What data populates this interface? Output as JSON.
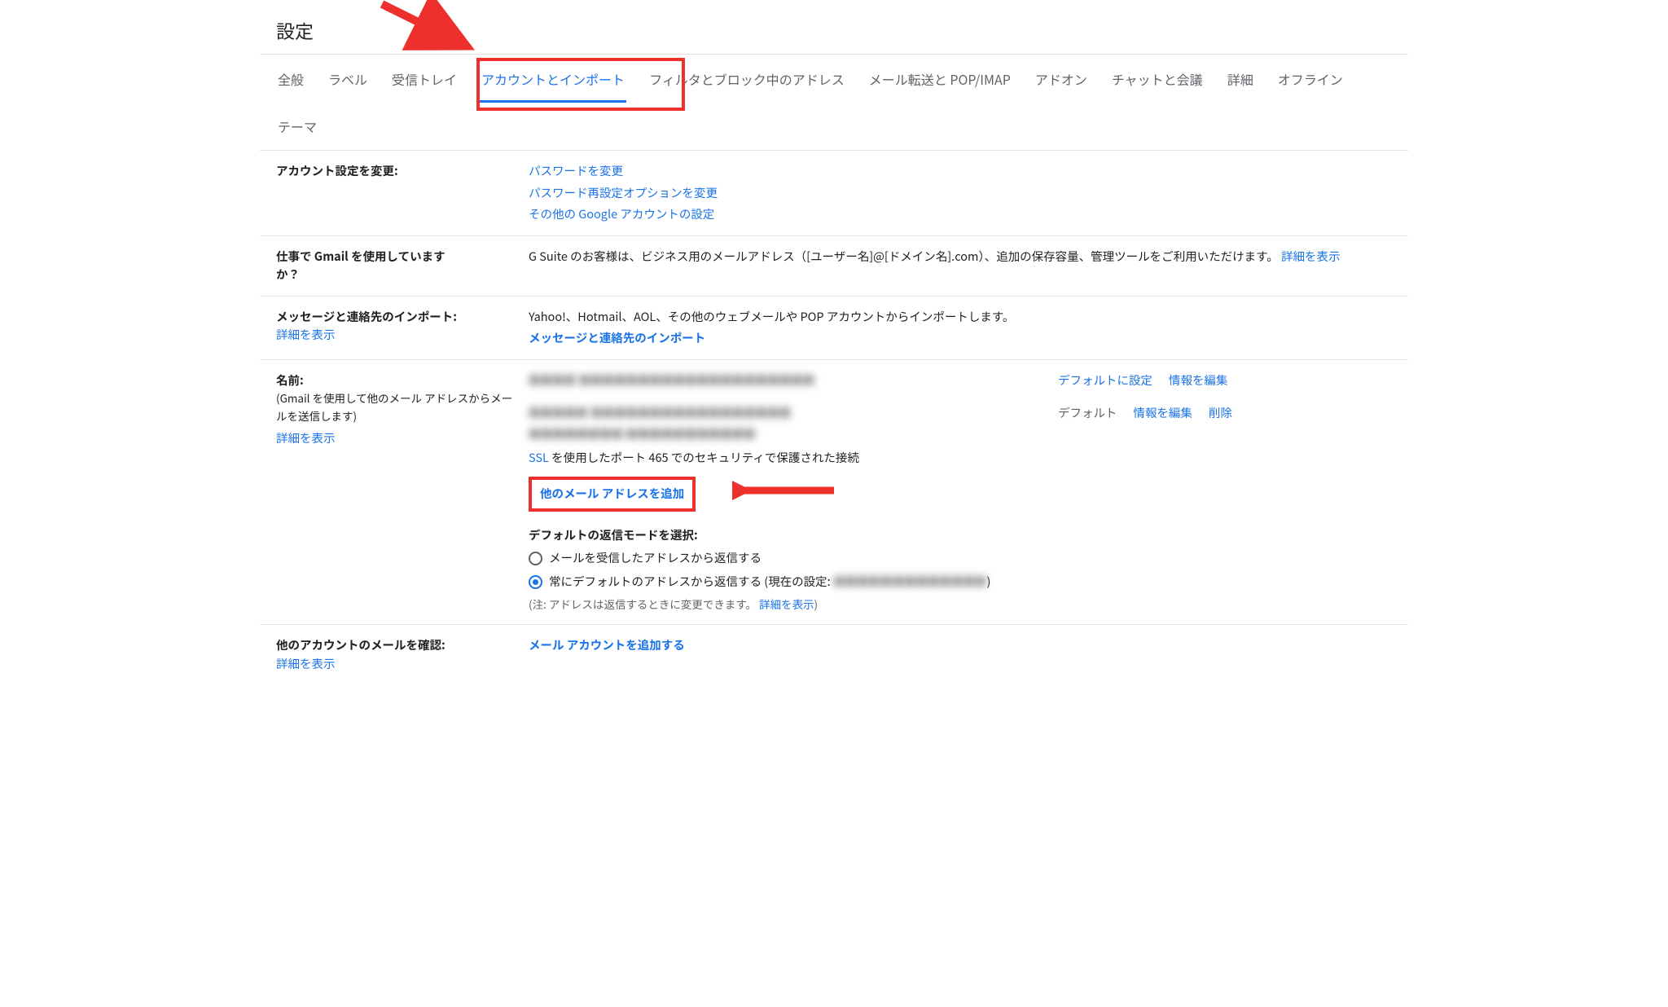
{
  "page_title": "設定",
  "tabs": {
    "general": "全般",
    "labels": "ラベル",
    "inbox": "受信トレイ",
    "accounts": "アカウントとインポート",
    "filters": "フィルタとブロック中のアドレス",
    "forwarding": "メール転送と POP/IMAP",
    "addons": "アドオン",
    "chat": "チャットと会議",
    "advanced": "詳細",
    "offline": "オフライン",
    "themes": "テーマ"
  },
  "sec_account": {
    "label": "アカウント設定を変更:",
    "change_pw": "パスワードを変更",
    "change_recovery": "パスワード再設定オプションを変更",
    "other_settings": "その他の Google アカウントの設定"
  },
  "sec_gsuite": {
    "label_a": "仕事で Gmail を使用しています",
    "label_b": "か？",
    "body": "G Suite のお客様は、ビジネス用のメールアドレス（[ユーザー名]@[ドメイン名].com）、追加の保存容量、管理ツールをご利用いただけます。",
    "learn": "詳細を表示"
  },
  "sec_import": {
    "label": "メッセージと連絡先のインポート:",
    "learn": "詳細を表示",
    "body": "Yahoo!、Hotmail、AOL、その他のウェブメールや POP アカウントからインポートします。",
    "action": "メッセージと連絡先のインポート"
  },
  "sec_name": {
    "label": "名前:",
    "sub": "(Gmail を使用して他のメール アドレスからメールを送信します)",
    "learn": "詳細を表示",
    "blur1a": "■■■■",
    "blur1b": "  ■■■■■■■■■■■■■■■■■■■■",
    "set_default": "デフォルトに設定",
    "edit_info": "情報を編集",
    "blur2a": "■■■■■",
    "blur2b": "  ■■■■■■■■■■■■■■■■■",
    "default_text": "デフォルト",
    "delete": "削除",
    "blur3": "■■■■■■■■   ■■■■■■■■■■■",
    "ssl_label": "SSL",
    "ssl_rest": " を使用したポート 465 でのセキュリティで保護された接続",
    "add_addr": "他のメール アドレスを追加",
    "mode_title": "デフォルトの返信モードを選択:",
    "radio1": "メールを受信したアドレスから返信する",
    "radio2a": "常にデフォルトのアドレスから返信する (現在の設定: ",
    "radio2_blur": "■■■■■■■■■■■■■",
    "radio2b": ")",
    "note_a": "(注: アドレスは返信するときに変更できます。",
    "note_learn": "詳細を表示",
    "note_b": ")"
  },
  "sec_check": {
    "label": "他のアカウントのメールを確認:",
    "learn": "詳細を表示",
    "action": "メール アカウントを追加する"
  }
}
